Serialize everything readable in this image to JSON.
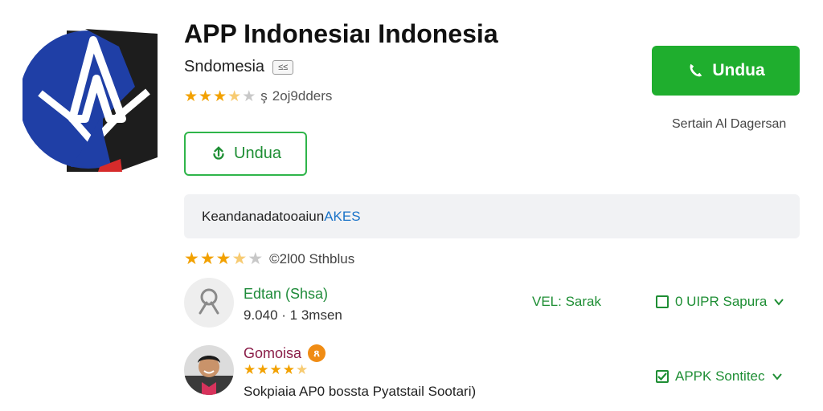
{
  "app": {
    "title": "APP Indonesiaı Indonesia",
    "subtitle": "Sndomesia",
    "subtitle_badge": "≤≤",
    "rating_value": 3.5,
    "rating_extra": "2oj9dders",
    "rating_sep": "ş"
  },
  "buttons": {
    "secondary_download": "Undua",
    "primary_download": "Undua"
  },
  "right_caption": "Sertain Al Dagersan",
  "info_bar": {
    "text": "Keandanadatooaiun ",
    "link": "AKES"
  },
  "reviews": {
    "rating_value": 3.5,
    "summary": "©2l00 Sthblus",
    "items": [
      {
        "name": "Edtan (Shsa)",
        "meta": "9.040 · 1 3msen",
        "tag": "VEL: Sarak",
        "action": "0 UIPR Sapura",
        "checked": false
      },
      {
        "name": "Gomoisa",
        "badge": "ጸ",
        "rating_value": 4.5,
        "text": "Sokpiaia AP0 bossta Pyatstail Sootari)",
        "action": "APPK Sontitec",
        "checked": true
      }
    ]
  },
  "colors": {
    "primary_green": "#1fae2e",
    "outline_green": "#2fb54a",
    "star": "#f2a100",
    "link_blue": "#1a73c8",
    "logo_blue": "#1f3fa6",
    "logo_dark": "#1d1d1d",
    "logo_red": "#d62b2b"
  },
  "icons": {
    "primary_button": "phone-download-icon",
    "secondary_button": "download-icon",
    "avatar_placeholder": "user-placeholder-icon",
    "chevron": "chevron-down-icon"
  }
}
